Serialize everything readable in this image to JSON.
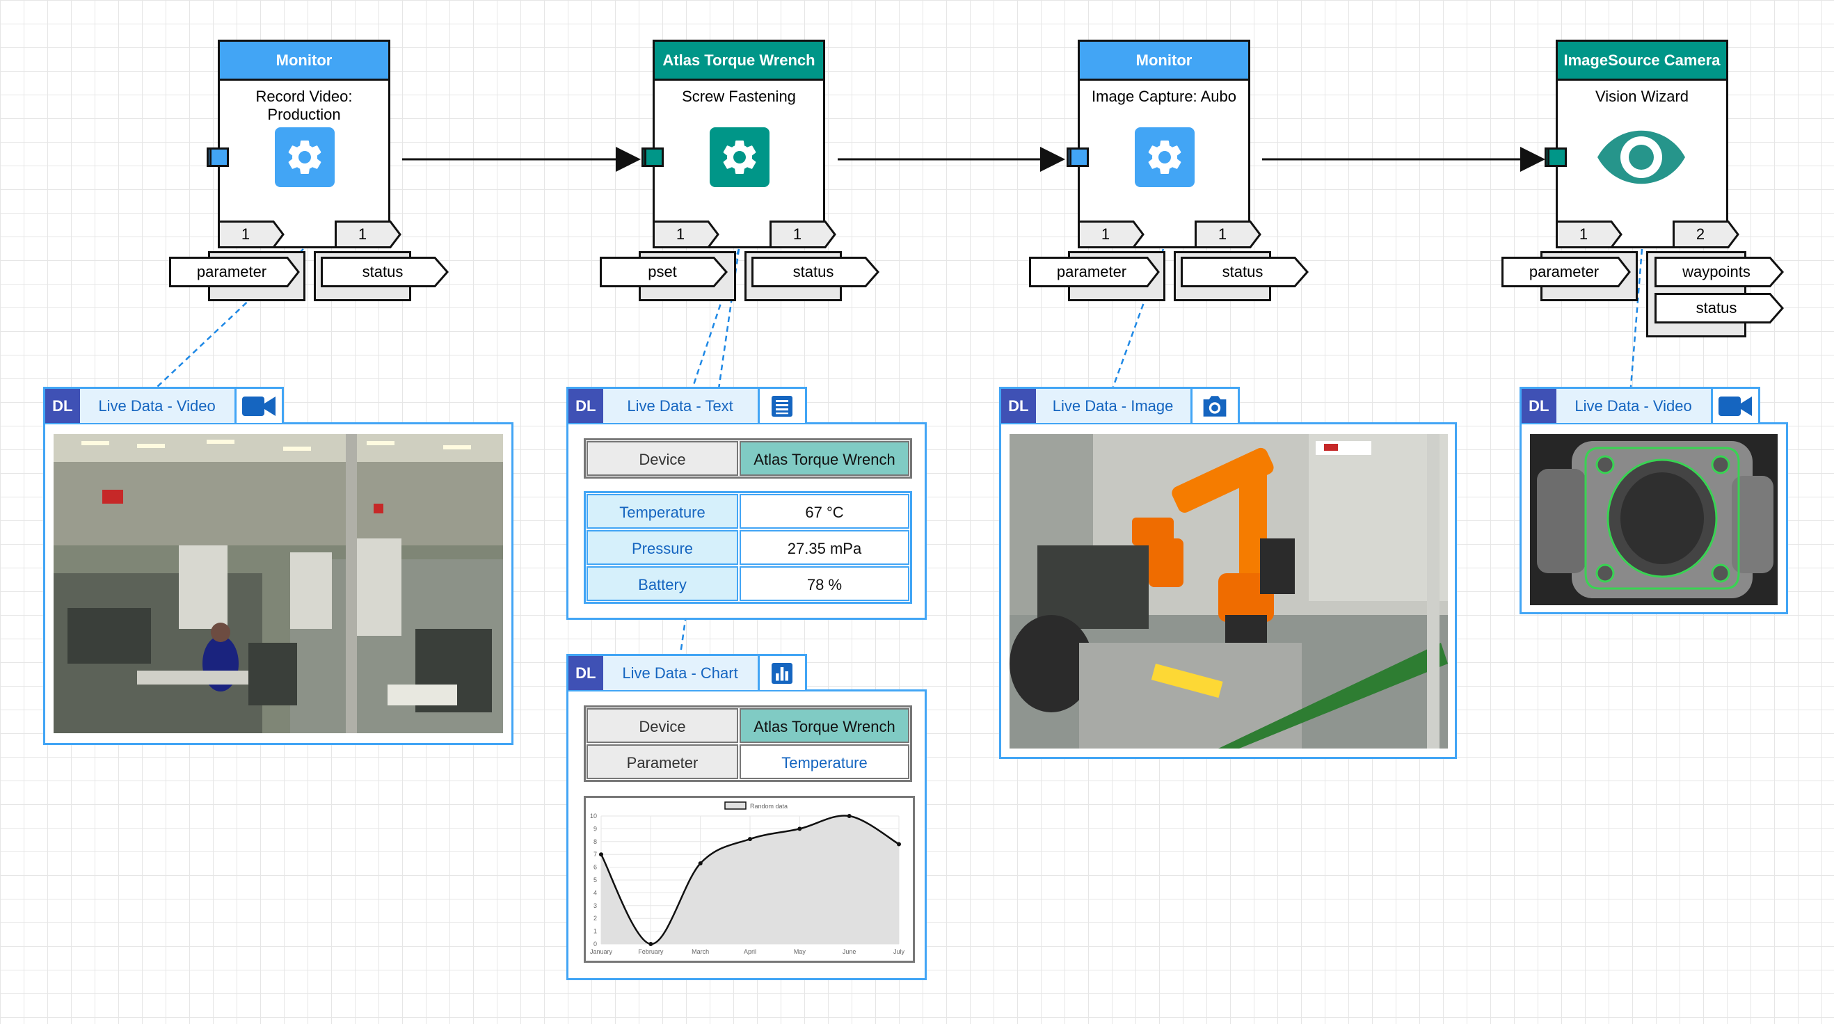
{
  "nodes": [
    {
      "header": "Monitor",
      "subtitle": "Record Video: Production",
      "count_left": "1",
      "count_right": "1",
      "params": [
        "parameter"
      ],
      "outputs": [
        "status"
      ]
    },
    {
      "header": "Atlas Torque Wrench",
      "subtitle": "Screw Fastening",
      "count_left": "1",
      "count_right": "1",
      "params": [
        "pset"
      ],
      "outputs": [
        "status"
      ]
    },
    {
      "header": "Monitor",
      "subtitle": "Image Capture: Aubo",
      "count_left": "1",
      "count_right": "1",
      "params": [
        "parameter"
      ],
      "outputs": [
        "status"
      ]
    },
    {
      "header": "ImageSource Camera",
      "subtitle": "Vision Wizard",
      "count_left": "1",
      "count_right": "2",
      "params": [
        "parameter"
      ],
      "outputs": [
        "waypoints",
        "status"
      ]
    }
  ],
  "panels": {
    "video1": {
      "badge": "DL",
      "title": "Live Data - Video",
      "icon": "videocam-icon"
    },
    "text": {
      "badge": "DL",
      "title": "Live Data - Text",
      "icon": "notes-icon",
      "device_label": "Device",
      "device_value": "Atlas Torque Wrench",
      "rows": [
        {
          "label": "Temperature",
          "value": "67 °C"
        },
        {
          "label": "Pressure",
          "value": "27.35 mPa"
        },
        {
          "label": "Battery",
          "value": "78 %"
        }
      ]
    },
    "chart": {
      "badge": "DL",
      "title": "Live Data - Chart",
      "icon": "bar-chart-icon",
      "device_label": "Device",
      "device_value": "Atlas Torque Wrench",
      "param_label": "Parameter",
      "param_value": "Temperature"
    },
    "image": {
      "badge": "DL",
      "title": "Live Data - Image",
      "icon": "camera-icon"
    },
    "video2": {
      "badge": "DL",
      "title": "Live Data - Video",
      "icon": "videocam-icon"
    }
  },
  "chart_data": {
    "type": "area",
    "categories": [
      "January",
      "February",
      "March",
      "April",
      "May",
      "June",
      "July"
    ],
    "series": [
      {
        "name": "Random data",
        "values": [
          7,
          0,
          6.3,
          8.2,
          9,
          10,
          7.8
        ]
      }
    ],
    "ylim": [
      0,
      10
    ],
    "yticks": [
      "10",
      "9",
      "8",
      "7",
      "6",
      "5",
      "4",
      "3",
      "2",
      "1",
      "0"
    ],
    "legend": "top-center",
    "grid": true,
    "colors": {
      "fill": "#e0e0e0",
      "line": "#111111"
    }
  },
  "colors": {
    "blue": "#42a5f5",
    "teal": "#009688",
    "indigo": "#3f51b5",
    "panel_border": "#42a5f5"
  }
}
